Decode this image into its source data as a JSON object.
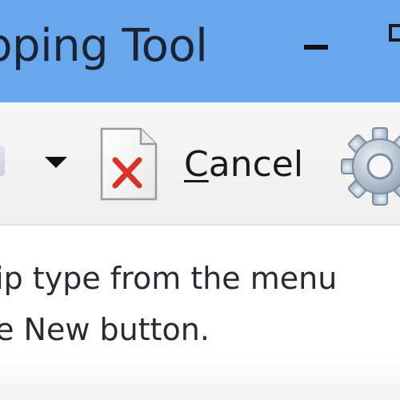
{
  "window": {
    "title": "Snipping Tool",
    "title_visible": "pping Tool"
  },
  "toolbar": {
    "cancel_label_prefix": "",
    "cancel_label_hotkey": "C",
    "cancel_label_rest": "ancel"
  },
  "message": {
    "line1": "nip type from the menu",
    "line2": "he New button."
  },
  "icons": {
    "minimize": "minimize-icon",
    "maximize": "maximize-icon",
    "dropdown": "chevron-down-icon",
    "cancel": "cancel-document-icon",
    "options": "gear-icon"
  },
  "colors": {
    "titlebar": "#68a7ec",
    "toolbar": "#f2f2f2",
    "cancel_x": "#d9322b"
  }
}
